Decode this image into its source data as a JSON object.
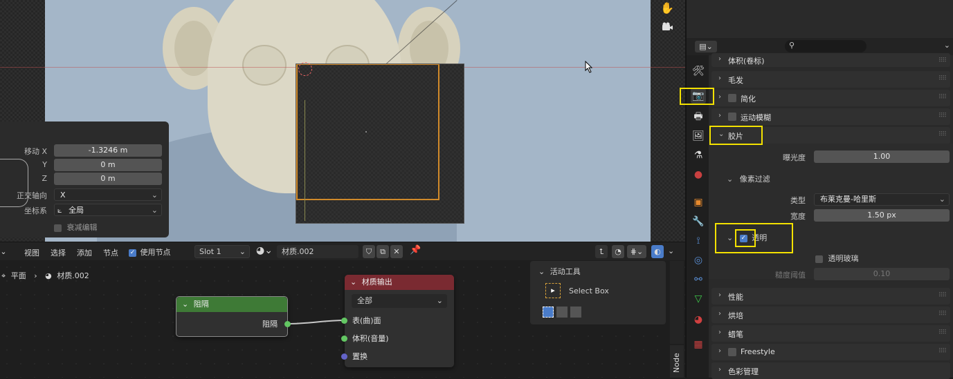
{
  "colors": {
    "accent": "#4a7cc9",
    "selection": "#d18a2a",
    "highlight": "#f4e200",
    "node_green": "#3e7a36",
    "node_red": "#7a2a31",
    "socket_green": "#63c763",
    "socket_purple": "#6363c7"
  },
  "operator_panel": {
    "move_x_label": "移动 X",
    "move_x_value": "-1.3246 m",
    "y_label": "Y",
    "y_value": "0 m",
    "z_label": "Z",
    "z_value": "0 m",
    "ortho_label": "正交轴向",
    "ortho_value": "X",
    "coord_label": "坐标系",
    "coord_value": "全局",
    "falloff_label": "衰减编辑"
  },
  "node_header": {
    "view": "视图",
    "select": "选择",
    "add": "添加",
    "node": "节点",
    "use_nodes": "使用节点",
    "slot": "Slot 1",
    "material": "材质.002"
  },
  "breadcrumb": {
    "object": "平面",
    "material": "材质.002"
  },
  "nodes": {
    "holdout": {
      "title": "阻隔",
      "output": "阻隔"
    },
    "output": {
      "title": "材质输出",
      "target": "全部",
      "surface": "表(曲)面",
      "volume": "体积(音量)",
      "displacement": "置换"
    }
  },
  "tool_panel": {
    "title": "活动工具",
    "tool": "Select Box"
  },
  "node_tab": "Node",
  "properties": {
    "sections": {
      "volume": "体积(卷标)",
      "hair": "毛发",
      "simplify": "简化",
      "motion_blur": "运动模糊",
      "film": "胶片",
      "performance": "性能",
      "bake": "烘培",
      "grease_pencil": "蜡笔",
      "freestyle": "Freestyle",
      "color_mgmt": "色彩管理"
    },
    "exposure_label": "曝光度",
    "exposure_value": "1.00",
    "pixel_filter": "像素过滤",
    "type_label": "类型",
    "type_value": "布莱克曼-哈里斯",
    "width_label": "宽度",
    "width_value": "1.50 px",
    "transparent": "透明",
    "transparent_glass": "透明玻璃",
    "roughness_label": "糙度阈值",
    "roughness_value": "0.10"
  }
}
